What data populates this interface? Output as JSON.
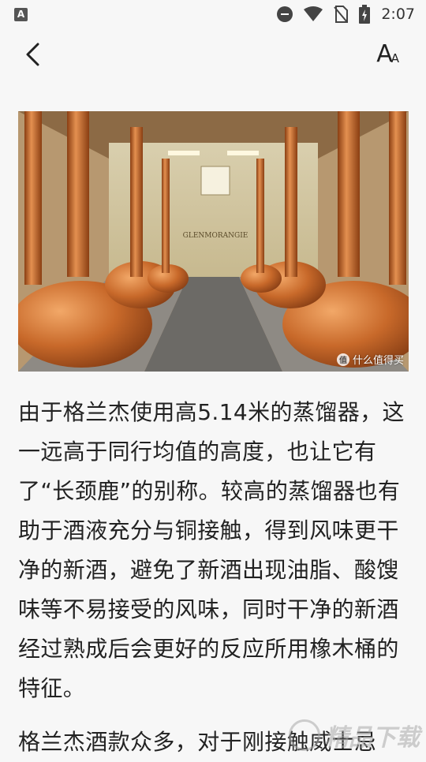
{
  "status_bar": {
    "time": "2:07",
    "app_badge": "A",
    "icons": [
      "dnd-icon",
      "wifi-icon",
      "no-sim-icon",
      "battery-charging-icon"
    ]
  },
  "toolbar": {
    "back_icon": "chevron-left-icon",
    "font_icon": "font-size-icon",
    "font_big": "A",
    "font_small": "A"
  },
  "article": {
    "image": {
      "sign": "GLENMORANGIE",
      "watermark": "什么值得买",
      "watermark_icon": "值"
    },
    "paragraphs": [
      "由于格兰杰使用高5.14米的蒸馏器，这一远高于同行均值的高度，也让它有了“长颈鹿”的别称。较高的蒸馏器也有助于酒液充分与铜接触，得到风味更干净的新酒，避免了新酒出现油脂、酸馊味等不易接受的风味，同时干净的新酒经过熟成后会更好的反应所用橡木桶的特征。",
      "格兰杰酒款众多，对于刚接触威士忌"
    ]
  },
  "site_watermark": "精品下载",
  "colors": {
    "copper": "#c26a2a",
    "background": "#f7f7f7",
    "text": "#222222"
  }
}
